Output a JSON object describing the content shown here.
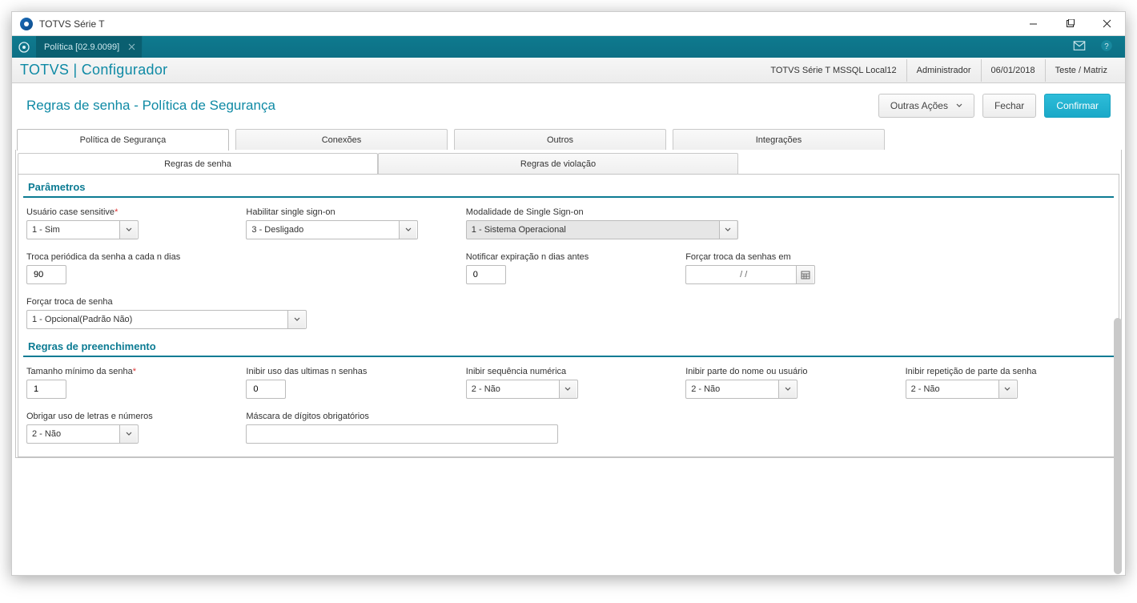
{
  "window": {
    "title": "TOTVS Série T"
  },
  "tabstrip": {
    "doc_label": "Política [02.9.0099]"
  },
  "app_header": {
    "title": "TOTVS | Configurador",
    "env": "TOTVS Série T  MSSQL Local12",
    "user": "Administrador",
    "date": "06/01/2018",
    "branch": "Teste / Matriz"
  },
  "sub_header": {
    "title": "Regras de senha - Política de Segurança",
    "btn_other": "Outras Ações",
    "btn_close": "Fechar",
    "btn_confirm": "Confirmar"
  },
  "tabs_level1": [
    "Política de Segurança",
    "Conexões",
    "Outros",
    "Integrações"
  ],
  "tabs_level2": [
    "Regras de senha",
    "Regras de violação"
  ],
  "sections": {
    "parametros": "Parâmetros",
    "regras_preenchimento": "Regras de preenchimento"
  },
  "fields": {
    "case_sensitive": {
      "label": "Usuário case sensitive",
      "value": "1 - Sim"
    },
    "sso_enable": {
      "label": "Habilitar single sign-on",
      "value": "3 - Desligado"
    },
    "sso_mode": {
      "label": "Modalidade de Single Sign-on",
      "value": "1 - Sistema Operacional"
    },
    "troca_periodica": {
      "label": "Troca periódica da senha a cada n dias",
      "value": "90"
    },
    "notif_exp": {
      "label": "Notificar expiração n dias antes",
      "value": "0"
    },
    "forcar_troca_em": {
      "label": "Forçar troca da senhas em",
      "value": "/  /"
    },
    "forcar_troca": {
      "label": "Forçar troca de senha",
      "value": "1 - Opcional(Padrão Não)"
    },
    "tam_min": {
      "label": "Tamanho mínimo da senha",
      "value": "1"
    },
    "inibir_ultimas": {
      "label": "Inibir uso das ultimas n senhas",
      "value": "0"
    },
    "inibir_seq": {
      "label": "Inibir sequência numérica",
      "value": "2 - Não"
    },
    "inibir_nome": {
      "label": "Inibir parte do nome ou usuário",
      "value": "2 - Não"
    },
    "inibir_repet": {
      "label": "Inibir repetição de parte da senha",
      "value": "2 - Não"
    },
    "obrigar_letras": {
      "label": "Obrigar uso de letras e números",
      "value": "2 - Não"
    },
    "mascara": {
      "label": "Máscara de dígitos obrigatórios",
      "value": ""
    }
  }
}
